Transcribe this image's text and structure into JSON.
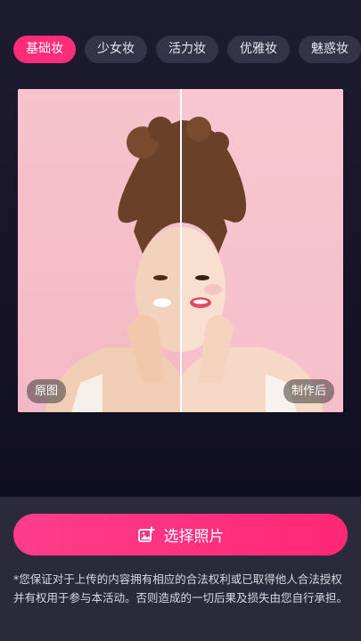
{
  "tabs": [
    {
      "label": "基础妆",
      "active": true
    },
    {
      "label": "少女妆",
      "active": false
    },
    {
      "label": "活力妆",
      "active": false
    },
    {
      "label": "优雅妆",
      "active": false
    },
    {
      "label": "魅惑妆",
      "active": false
    }
  ],
  "compare": {
    "before_label": "原图",
    "after_label": "制作后"
  },
  "action": {
    "select_photo_label": "选择照片",
    "icon": "add-image-icon"
  },
  "disclaimer": "*您保证对于上传的内容拥有相应的合法权利或已取得他人合法授权并有权用于参与本活动。否则造成的一切后果及损失由您自行承担。",
  "colors": {
    "accent": "#ff2d78",
    "background": "#1e1c30",
    "panel": "#2a2a3a",
    "tab_inactive": "#34334a"
  }
}
